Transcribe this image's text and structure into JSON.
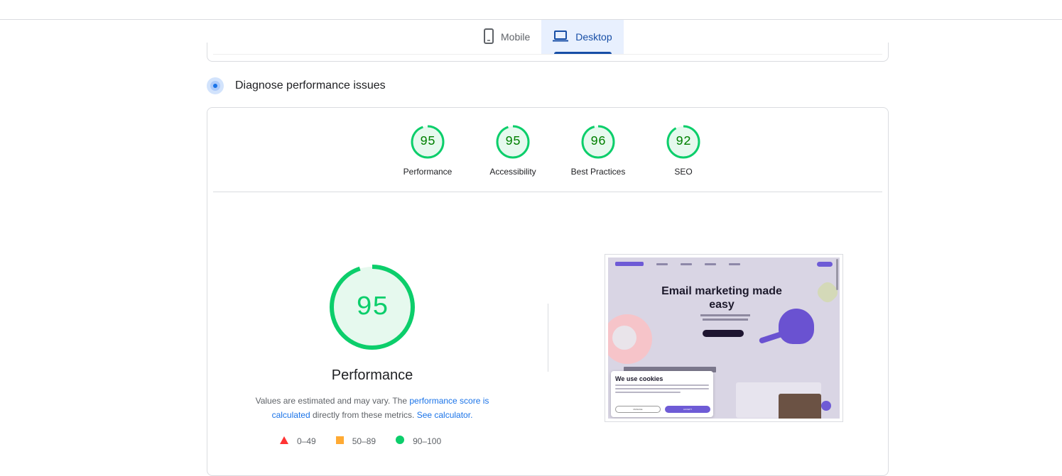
{
  "tabs": [
    {
      "label": "Mobile",
      "icon": "phone-icon",
      "active": false
    },
    {
      "label": "Desktop",
      "icon": "laptop-icon",
      "active": true
    }
  ],
  "section": {
    "title": "Diagnose performance issues",
    "icon": "diagnose-icon"
  },
  "gauges": [
    {
      "score": "95",
      "label": "Performance"
    },
    {
      "score": "95",
      "label": "Accessibility"
    },
    {
      "score": "96",
      "label": "Best Practices"
    },
    {
      "score": "92",
      "label": "SEO"
    }
  ],
  "main": {
    "score": "95",
    "title": "Performance",
    "desc_prefix": "Values are estimated and may vary. The ",
    "desc_link1": "performance score is calculated",
    "desc_middle": " directly from these metrics. ",
    "desc_link2": "See calculator.",
    "legend": [
      {
        "range": "0–49",
        "shape": "triangle",
        "color": "#ff3333"
      },
      {
        "range": "50–89",
        "shape": "square",
        "color": "#ffaa33"
      },
      {
        "range": "90–100",
        "shape": "circle",
        "color": "#0cce6b"
      }
    ]
  },
  "screenshot": {
    "headline": "Email marketing made easy",
    "cookie_title": "We use cookies",
    "cookie_manage": "MANAGE",
    "cookie_accept": "ACCEPT"
  },
  "colors": {
    "pass": "#0cce6b",
    "pass_text": "#008000",
    "pass_bg": "#e6f9ee",
    "link": "#1a73e8",
    "active_tab": "#174ea6"
  }
}
